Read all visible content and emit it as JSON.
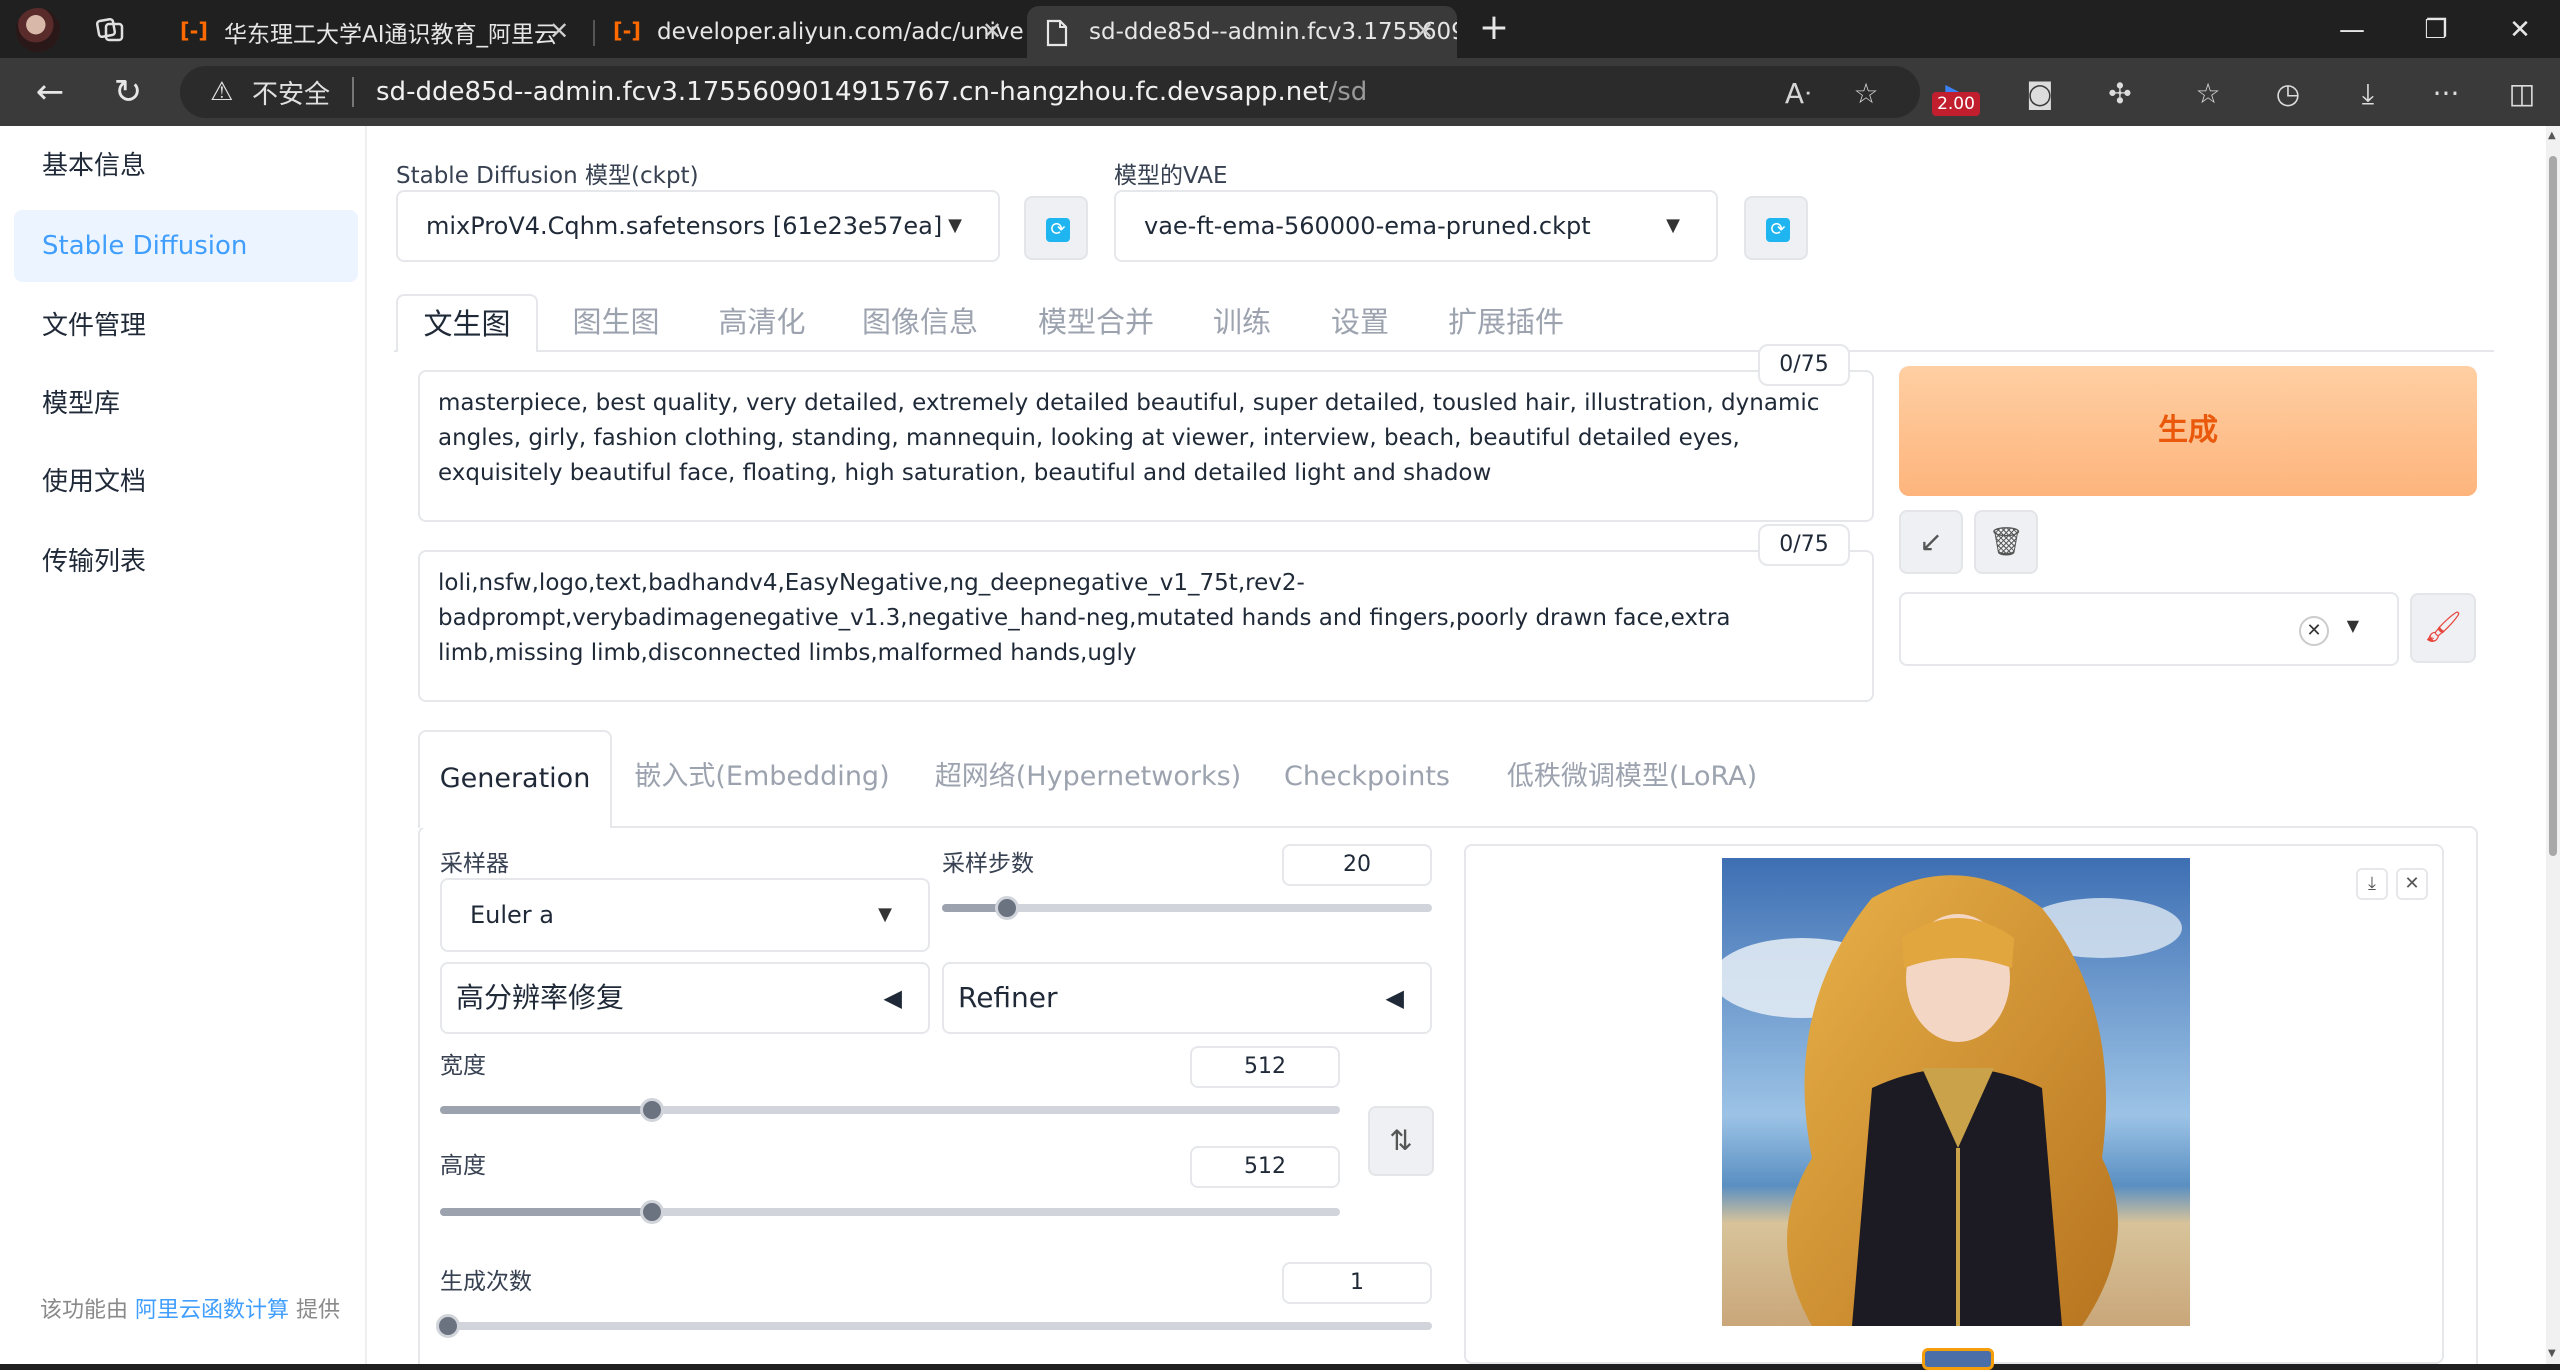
{
  "browser": {
    "tabs": [
      {
        "title": "华东理工大学AI通识教育_阿里云",
        "icon": "aliyun-icon"
      },
      {
        "title": "developer.aliyun.com/adc/univer",
        "icon": "aliyun-icon"
      },
      {
        "title": "sd-dde85d--admin.fcv3.1755609",
        "icon": "page-icon"
      }
    ],
    "security_label": "不安全",
    "url_host": "sd-dde85d--admin.fcv3.1755609014915767.cn-hangzhou.fc.devsapp.net",
    "url_path": "/sd",
    "extension_badge": "2.00"
  },
  "sidebar": {
    "items": [
      {
        "label": "基本信息"
      },
      {
        "label": "Stable Diffusion"
      },
      {
        "label": "文件管理"
      },
      {
        "label": "模型库"
      },
      {
        "label": "使用文档"
      },
      {
        "label": "传输列表"
      }
    ],
    "footer_prefix": "该功能由",
    "footer_link": "阿里云函数计算",
    "footer_suffix": "提供"
  },
  "models": {
    "ckpt_label": "Stable Diffusion 模型(ckpt)",
    "ckpt_value": "mixProV4.Cqhm.safetensors [61e23e57ea]",
    "vae_label": "模型的VAE",
    "vae_value": "vae-ft-ema-560000-ema-pruned.ckpt"
  },
  "main_tabs": [
    "文生图",
    "图生图",
    "高清化",
    "图像信息",
    "模型合并",
    "训练",
    "设置",
    "扩展插件"
  ],
  "prompt": {
    "positive": "masterpiece, best quality, very detailed, extremely detailed beautiful, super detailed, tousled hair, illustration, dynamic angles, girly, fashion clothing, standing, mannequin, looking at viewer, interview, beach, beautiful detailed eyes, exquisitely beautiful face, floating, high saturation, beautiful and detailed light and shadow",
    "positive_count": "0/75",
    "negative": "loli,nsfw,logo,text,badhandv4,EasyNegative,ng_deepnegative_v1_75t,rev2-badprompt,verybadimagenegative_v1.3,negative_hand-neg,mutated hands and fingers,poorly drawn face,extra limb,missing limb,disconnected limbs,malformed hands,ugly",
    "negative_count": "0/75"
  },
  "generate_label": "生成",
  "sub_tabs": [
    "Generation",
    "嵌入式(Embedding)",
    "超网络(Hypernetworks)",
    "Checkpoints",
    "低秩微调模型(LoRA)"
  ],
  "generation": {
    "sampler_label": "采样器",
    "sampler_value": "Euler a",
    "steps_label": "采样步数",
    "steps_value": "20",
    "steps_fraction": 0.133,
    "hires_label": "高分辨率修复",
    "refiner_label": "Refiner",
    "width_label": "宽度",
    "width_value": "512",
    "width_fraction": 0.235,
    "height_label": "高度",
    "height_value": "512",
    "height_fraction": 0.235,
    "batch_count_label": "生成次数",
    "batch_count_value": "1",
    "batch_count_fraction": 0.0
  }
}
